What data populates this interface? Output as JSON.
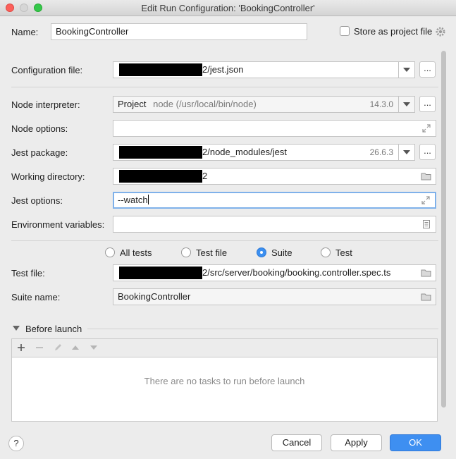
{
  "window": {
    "title": "Edit Run Configuration: 'BookingController'"
  },
  "name": {
    "label": "Name:",
    "value": "BookingController"
  },
  "store_project_file": {
    "label": "Store as project file",
    "checked": false
  },
  "config_file": {
    "label": "Configuration file:",
    "value": "2/jest.json"
  },
  "node_interpreter": {
    "label": "Node interpreter:",
    "primary": "Project",
    "path": "node (/usr/local/bin/node)",
    "version": "14.3.0"
  },
  "node_options": {
    "label": "Node options:",
    "value": ""
  },
  "jest_package": {
    "label": "Jest package:",
    "value": "2/node_modules/jest",
    "version": "26.6.3"
  },
  "working_dir": {
    "label": "Working directory:",
    "value": "2"
  },
  "jest_options": {
    "label": "Jest options:",
    "value": "--watch"
  },
  "env_vars": {
    "label": "Environment variables:",
    "value": ""
  },
  "scope": {
    "options": [
      "All tests",
      "Test file",
      "Suite",
      "Test"
    ],
    "selected": "Suite"
  },
  "test_file": {
    "label": "Test file:",
    "value": "2/src/server/booking/booking.controller.spec.ts"
  },
  "suite_name": {
    "label": "Suite name:",
    "value": "BookingController"
  },
  "before_launch": {
    "label": "Before launch",
    "empty_text": "There are no tasks to run before launch"
  },
  "ellipsis": "...",
  "help": "?",
  "buttons": {
    "cancel": "Cancel",
    "apply": "Apply",
    "ok": "OK"
  }
}
